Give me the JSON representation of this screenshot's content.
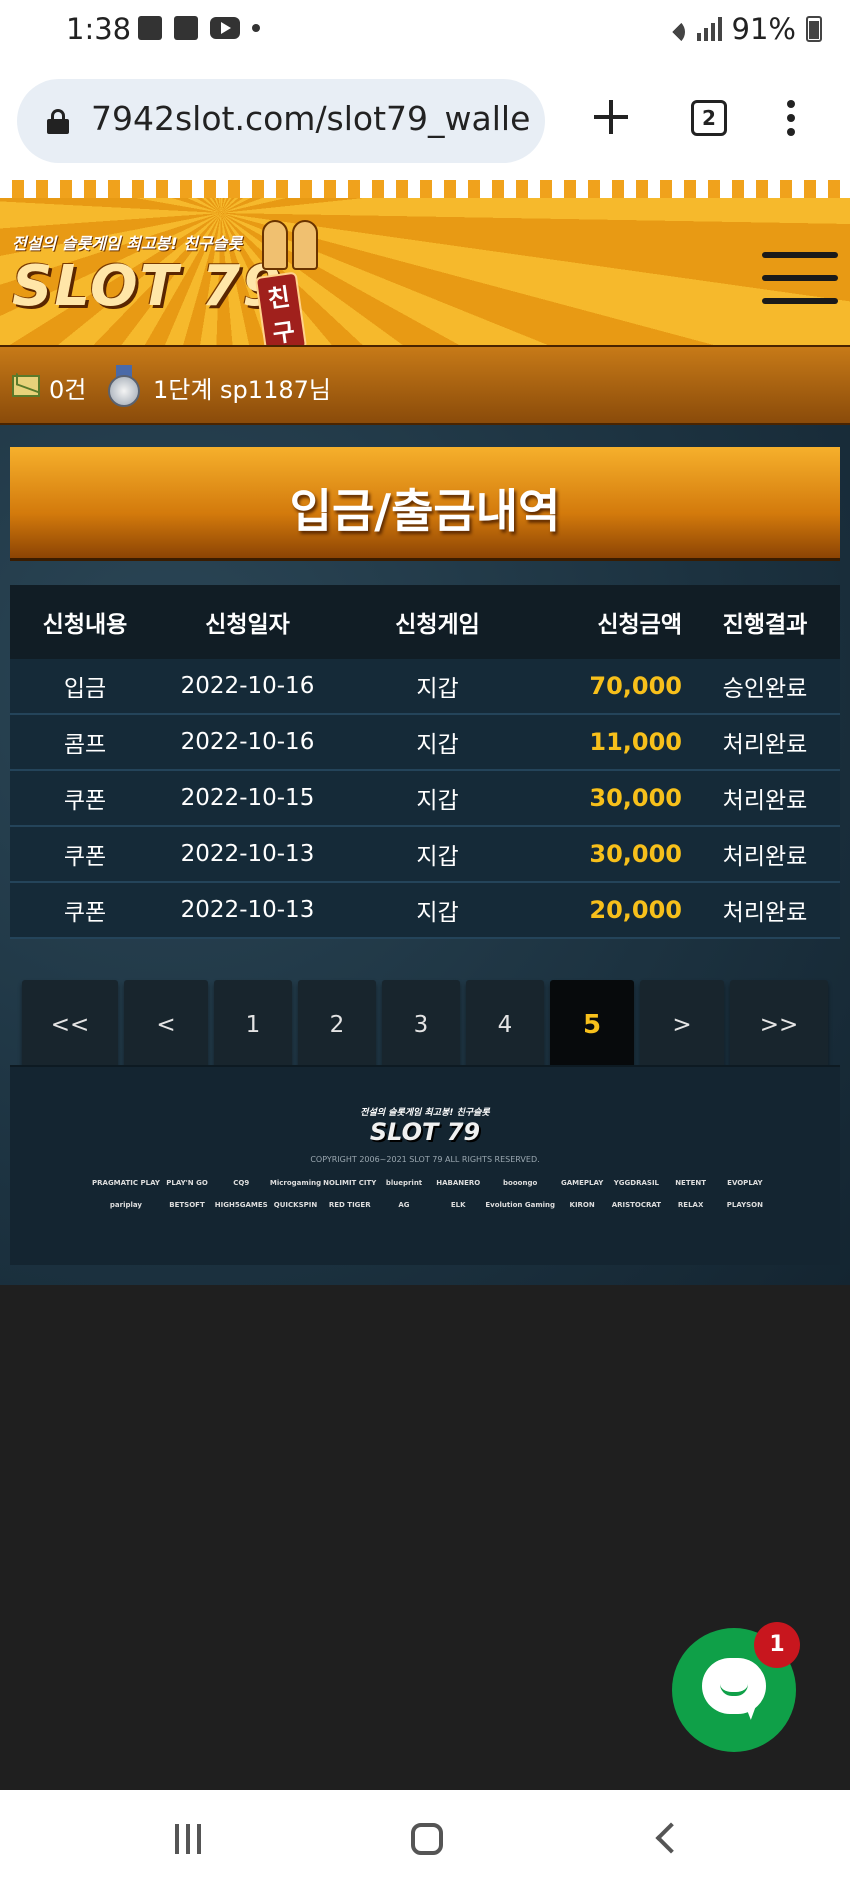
{
  "status": {
    "time": "1:38",
    "battery": "91%"
  },
  "browser": {
    "url": "7942slot.com/slot79_walle",
    "tab_count": "2"
  },
  "header": {
    "tagline": "전설의 슬롯게임 최고봉! 친구슬롯",
    "brand": "SLOT 79",
    "badge": "친구"
  },
  "userbar": {
    "mail_count": "0건",
    "level_user": "1단계 sp1187님"
  },
  "page": {
    "title": "입금/출금내역"
  },
  "table": {
    "headers": [
      "신청내용",
      "신청일자",
      "신청게임",
      "신청금액",
      "진행결과"
    ],
    "rows": [
      [
        "입금",
        "2022-10-16",
        "지갑",
        "70,000",
        "승인완료"
      ],
      [
        "콤프",
        "2022-10-16",
        "지갑",
        "11,000",
        "처리완료"
      ],
      [
        "쿠폰",
        "2022-10-15",
        "지갑",
        "30,000",
        "처리완료"
      ],
      [
        "쿠폰",
        "2022-10-13",
        "지갑",
        "30,000",
        "처리완료"
      ],
      [
        "쿠폰",
        "2022-10-13",
        "지갑",
        "20,000",
        "처리완료"
      ]
    ]
  },
  "pagination": {
    "first": "<<",
    "prev": "<",
    "pages": [
      "1",
      "2",
      "3",
      "4",
      "5"
    ],
    "current": "5",
    "next": ">",
    "last": ">>"
  },
  "footer": {
    "tagline": "전설의 슬롯게임 최고봉! 친구슬롯",
    "brand": "SLOT 79",
    "copyright": "COPYRIGHT 2006~2021 SLOT 79 ALL RIGHTS RESERVED.",
    "providers": [
      "PRAGMATIC PLAY",
      "PLAY'N GO",
      "CQ9",
      "Microgaming",
      "NOLIMIT CITY",
      "blueprint",
      "HABANERO",
      "booongo",
      "GAMEPLAY",
      "YGGDRASIL",
      "NETENT",
      "EVOPLAY",
      "pariplay",
      "BETSOFT",
      "HIGH5GAMES",
      "QUICKSPIN",
      "RED TIGER",
      "AG",
      "ELK",
      "Evolution Gaming",
      "KIRON",
      "ARISTOCRAT",
      "RELAX",
      "PLAYSON"
    ]
  },
  "chat": {
    "badge": "1"
  }
}
